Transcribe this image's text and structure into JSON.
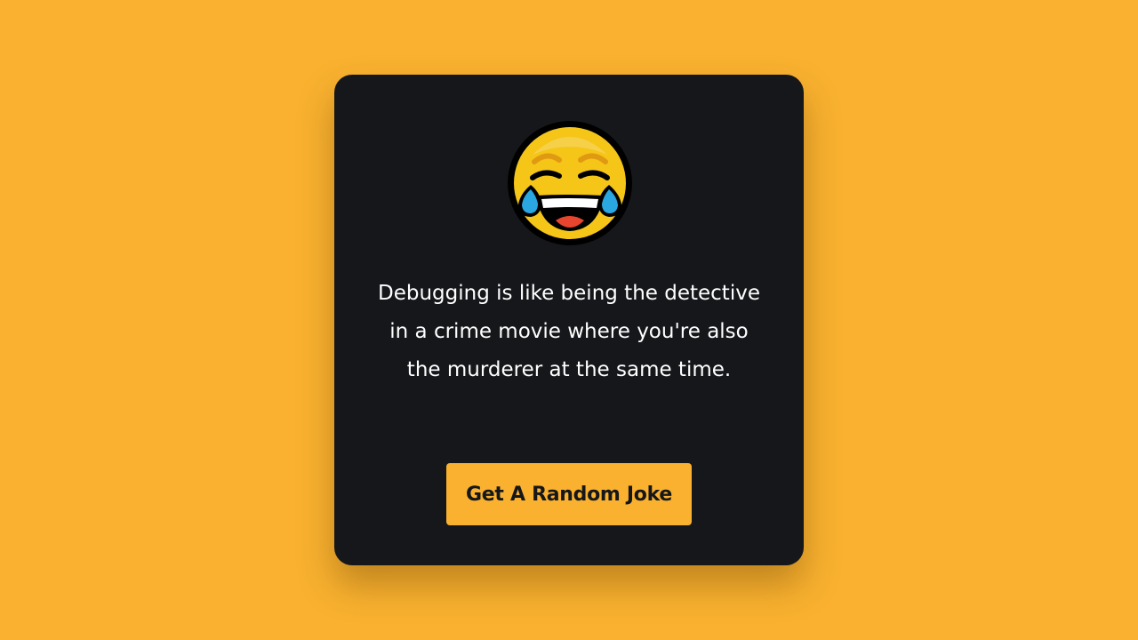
{
  "joke_card": {
    "emoji_icon": "face-with-tears-of-joy-icon",
    "joke_text": "Debugging is like being the detective in a crime movie where you're also the murderer at the same time.",
    "button_label": "Get A Random Joke"
  },
  "colors": {
    "background": "#f9b12f",
    "card": "#15171a",
    "button": "#f9b12f",
    "button_text": "#15171a",
    "text": "#ffffff"
  }
}
